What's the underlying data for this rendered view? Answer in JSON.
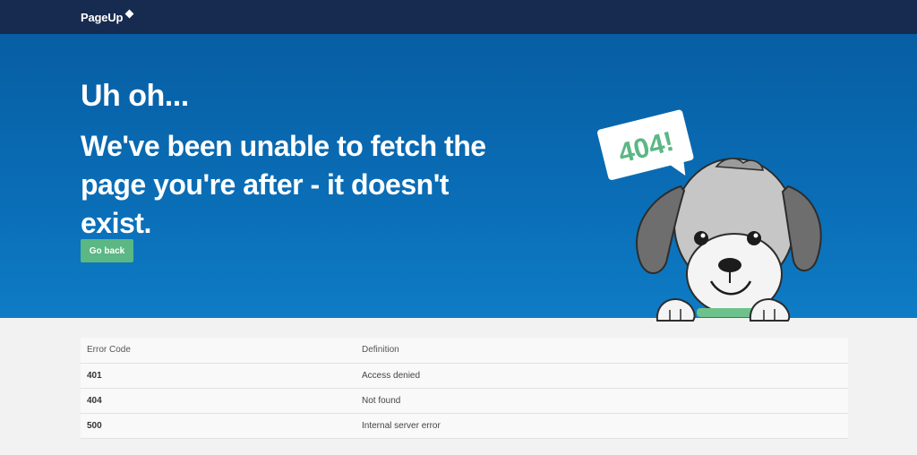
{
  "header": {
    "logo_text": "PageUp"
  },
  "hero": {
    "headline": "Uh oh...",
    "message": "We've been unable to fetch the page you're after - it doesn't exist.",
    "go_back_label": "Go back",
    "bubble_text": "404!"
  },
  "table": {
    "headers": [
      "Error Code",
      "Definition"
    ],
    "rows": [
      {
        "code": "401",
        "definition": "Access denied"
      },
      {
        "code": "404",
        "definition": "Not found"
      },
      {
        "code": "500",
        "definition": "Internal server error"
      }
    ]
  },
  "colors": {
    "topbar": "#172a4f",
    "hero_blue": "#0a6eb7",
    "button_green": "#5bb784",
    "collar_green": "#6cc28a"
  }
}
